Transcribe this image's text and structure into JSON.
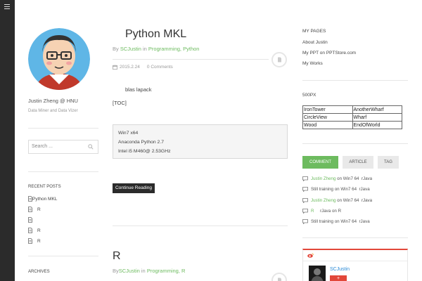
{
  "author": {
    "name": "Justin Zheng @ HNU",
    "subtitle": "Data Miner and Data Vizer"
  },
  "search": {
    "placeholder": "Search ..."
  },
  "recent_posts": {
    "title": "RECENT POSTS",
    "items": [
      "Python MKL",
      "R",
      "",
      "R",
      "R"
    ]
  },
  "archives": {
    "title": "ARCHIVES"
  },
  "posts": [
    {
      "title": "Python MKL",
      "by": "By",
      "author": "SCJustin",
      "in": "in",
      "categories": [
        "Programming",
        "Python"
      ],
      "date": "2015.2.24",
      "comments": "0 Comments",
      "paragraphs": [
        "blas lapack",
        "[TOC]"
      ],
      "code_lines": [
        "Win7 x64",
        "Anaconda Python 2.7",
        "Intel i5 M460@ 2.53GHz"
      ],
      "continue_label": "Continue Reading"
    },
    {
      "title": "R",
      "by": "By",
      "author": "SCJustin",
      "in": "in",
      "categories": [
        "Programming",
        "R"
      ]
    }
  ],
  "my_pages": {
    "title": "MY PAGES",
    "links": [
      "About Justin",
      "My PPT on PPTStore.com",
      "My Works"
    ]
  },
  "px500": {
    "title": "500PX",
    "grid": [
      [
        "IronTower",
        "AnotherWharf"
      ],
      [
        "CircleView",
        "Wharf"
      ],
      [
        "Wood",
        "EndOfWorld"
      ]
    ]
  },
  "tabs": [
    "COMMENT",
    "ARTICLE",
    "TAG"
  ],
  "recent_comments": [
    {
      "name": "Justin Zheng",
      "on": "on",
      "post": "Win7 64",
      "tail": "rJava"
    },
    {
      "name": "Still training",
      "on": "on",
      "post": "Win7 64",
      "tail": "rJava"
    },
    {
      "name": "Justin Zheng",
      "on": "on",
      "post": "Win7 64",
      "tail": "rJava"
    },
    {
      "name": "R",
      "on": "on",
      "post": "R",
      "tail": "rJava"
    },
    {
      "name": "Still training",
      "on": "on",
      "post": "Win7 64",
      "tail": "rJava"
    }
  ],
  "weibo": {
    "name": "SCJustin",
    "follow": "+"
  },
  "colors": {
    "accent": "#6dbb5f",
    "dark": "#2b2b2b",
    "weibo_red": "#e2473a"
  }
}
